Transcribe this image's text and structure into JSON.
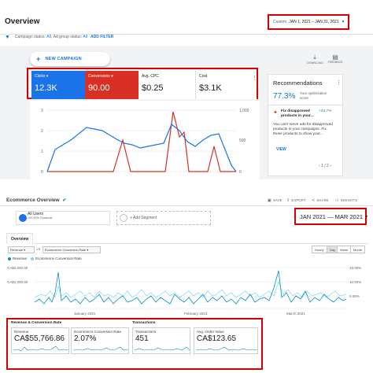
{
  "ads": {
    "title": "Overview",
    "date_range": {
      "label": "Custom",
      "value": "JAN 1, 2021 – JAN 31, 2021"
    },
    "filter_bar": {
      "campaign_status_label": "Campaign status:",
      "campaign_status_value": "All",
      "ad_group_status_label": "Ad group status:",
      "ad_group_status_value": "All",
      "add_filter": "ADD FILTER"
    },
    "new_campaign": "NEW CAMPAIGN",
    "tools": [
      {
        "label": "DOWNLOAD",
        "icon": "download-icon"
      },
      {
        "label": "FEEDBACK",
        "icon": "feedback-icon"
      }
    ],
    "metrics": [
      {
        "label": "Clicks",
        "value": "12.3K",
        "color": "#1a73e8"
      },
      {
        "label": "Conversions",
        "value": "90.00",
        "color": "#d93025"
      },
      {
        "label": "Avg. CPC",
        "value": "$0.25"
      },
      {
        "label": "Cost",
        "value": "$3.1K"
      }
    ],
    "chart": {
      "left_ticks": [
        "3",
        "2",
        "1",
        "0"
      ],
      "right_ticks": [
        "1,000",
        "500",
        "0"
      ]
    },
    "recommendations": {
      "title": "Recommendations",
      "score": "77.3%",
      "score_label": "Your optimization score",
      "item_title": "Fix disapproved products in your...",
      "item_delta": "+22.7%",
      "item_body": "You can't serve ads for disapproved products in your campaigns. Fix those products to show your...",
      "view": "VIEW",
      "pager": "1 / 2"
    }
  },
  "ga": {
    "title": "Ecommerce Overview",
    "actions": [
      "SAVE",
      "EXPORT",
      "SHARE",
      "INSIGHTS"
    ],
    "segment": {
      "name": "All Users",
      "sub": "100.00% Sessions",
      "add": "+ Add Segment"
    },
    "date_range": {
      "start": "JAN 2021",
      "sep": "—",
      "end": "MAR 2021"
    },
    "tab": "Overview",
    "controls": {
      "metric1": "Revenue",
      "vs": "VS",
      "metric2": "Ecommerce Conversion Rate",
      "periods": [
        "Hourly",
        "Day",
        "Week",
        "Month"
      ],
      "active_period": "Day"
    },
    "legend": [
      {
        "label": "Revenue",
        "color": "#058dc7"
      },
      {
        "label": "Ecommerce Conversion Rate",
        "color": "#7ed6f5"
      }
    ],
    "chart": {
      "left_ticks": [
        "CA$2,000.00",
        "CA$1,000.00"
      ],
      "right_ticks": [
        "15.00%",
        "10.00%",
        "5.00%"
      ],
      "x_labels": [
        "January 2021",
        "February 2021",
        "March 2021"
      ]
    },
    "summary": {
      "group1": "Revenue & Conversion Rate",
      "group2": "Transactions",
      "boxes": [
        {
          "label": "Revenue",
          "value": "CA$55,766.86"
        },
        {
          "label": "Ecommerce Conversion Rate",
          "value": "2.07%"
        },
        {
          "label": "Transactions",
          "value": "451"
        },
        {
          "label": "Avg. Order Value",
          "value": "CA$123.65"
        }
      ]
    }
  }
}
